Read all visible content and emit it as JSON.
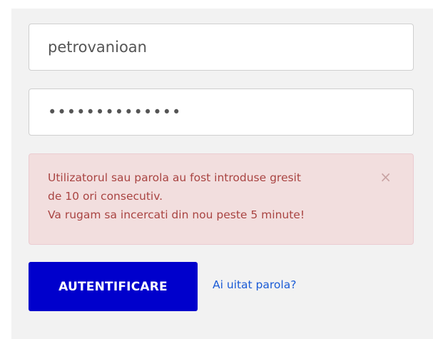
{
  "login_form": {
    "username_value": "petrovanioan",
    "password_value": "••••••••••••••",
    "alert": {
      "line1": "Utilizatorul sau parola au fost introduse gresit",
      "line2": "de 10 ori consecutiv.",
      "line3": "Va rugam sa incercati din nou peste 5 minute!",
      "close_glyph": "×"
    },
    "submit_label": "AUTENTIFICARE",
    "forgot_link": "Ai uitat parola?"
  },
  "colors": {
    "panel_bg": "#f2f2f2",
    "button_bg": "#0000cc",
    "alert_bg": "#f2dede",
    "alert_text": "#a94442",
    "link": "#1a5bd6"
  }
}
